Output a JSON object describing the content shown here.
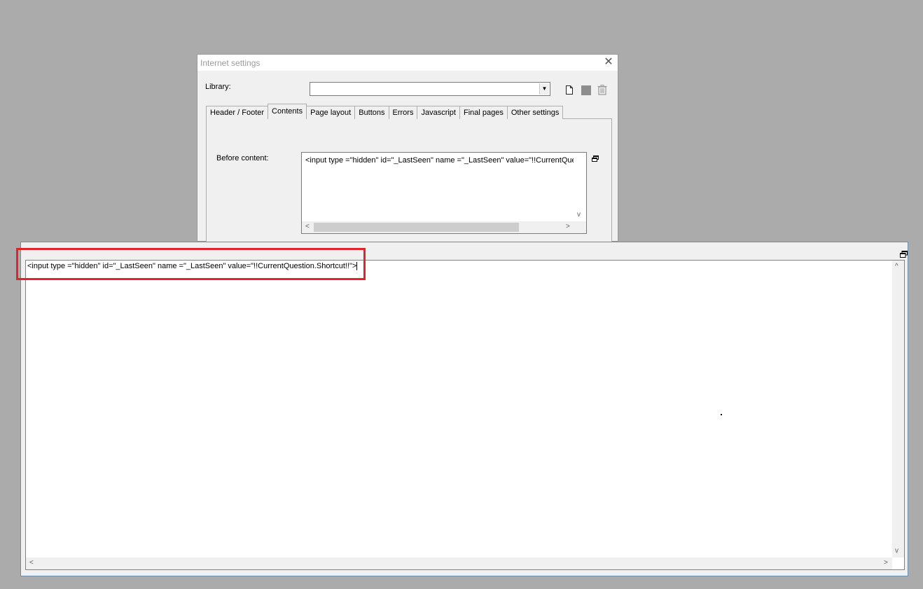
{
  "dialog": {
    "title": "Internet settings",
    "close_glyph": "✕",
    "library": {
      "label": "Library:",
      "value": "",
      "arrow_glyph": "▼"
    },
    "tabs": [
      {
        "label": "Header / Footer",
        "active": false
      },
      {
        "label": "Contents",
        "active": true
      },
      {
        "label": "Page layout",
        "active": false
      },
      {
        "label": "Buttons",
        "active": false
      },
      {
        "label": "Errors",
        "active": false
      },
      {
        "label": "Javascript",
        "active": false
      },
      {
        "label": "Final pages",
        "active": false
      },
      {
        "label": "Other settings",
        "active": false
      }
    ],
    "before_content": {
      "label": "Before content:",
      "value": "<input type =\"hidden\" id=\"_LastSeen\" name =\"_LastSeen\" value=\"!!CurrentQuestion.Shortcut!!\">"
    },
    "icons": [
      "new-document-icon",
      "save-icon",
      "trash-icon",
      "restore-window-icon"
    ]
  },
  "editor": {
    "text": "<input type =\"hidden\" id=\"_LastSeen\" name =\"_LastSeen\" value=\"!!CurrentQuestion.Shortcut!!\">",
    "icons": [
      "restore-window-icon"
    ]
  },
  "scroll_glyphs": {
    "left": "<",
    "right": ">",
    "up": "^",
    "down": "v"
  },
  "colors": {
    "background": "#ababab",
    "highlight": "#e3232b",
    "window": "#f0f0f0"
  }
}
